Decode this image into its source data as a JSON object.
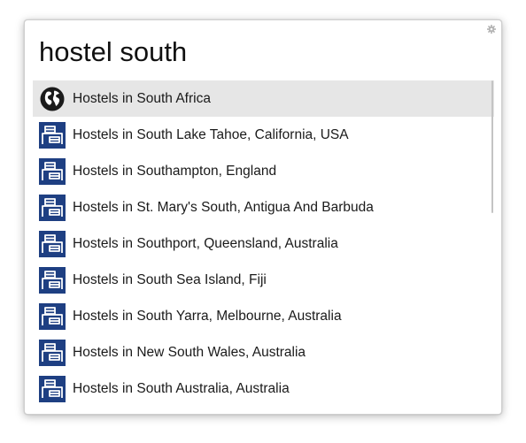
{
  "search": {
    "query": "hostel south"
  },
  "settings_icon": "gear-icon",
  "results": [
    {
      "label": "Hostels in South Africa",
      "icon": "globe-icon",
      "selected": true
    },
    {
      "label": "Hostels in South Lake Tahoe, California, USA",
      "icon": "hostel-bed-icon"
    },
    {
      "label": "Hostels in Southampton, England",
      "icon": "hostel-bed-icon"
    },
    {
      "label": "Hostels in St. Mary's South, Antigua And Barbuda",
      "icon": "hostel-bed-icon"
    },
    {
      "label": "Hostels in Southport, Queensland, Australia",
      "icon": "hostel-bed-icon"
    },
    {
      "label": "Hostels in South Sea Island, Fiji",
      "icon": "hostel-bed-icon"
    },
    {
      "label": "Hostels in South Yarra, Melbourne, Australia",
      "icon": "hostel-bed-icon"
    },
    {
      "label": "Hostels in New South Wales, Australia",
      "icon": "hostel-bed-icon"
    },
    {
      "label": "Hostels in South Australia, Australia",
      "icon": "hostel-bed-icon"
    }
  ],
  "colors": {
    "hostel_icon_bg": "#1e3f82",
    "selected_row_bg": "#e6e6e6"
  }
}
